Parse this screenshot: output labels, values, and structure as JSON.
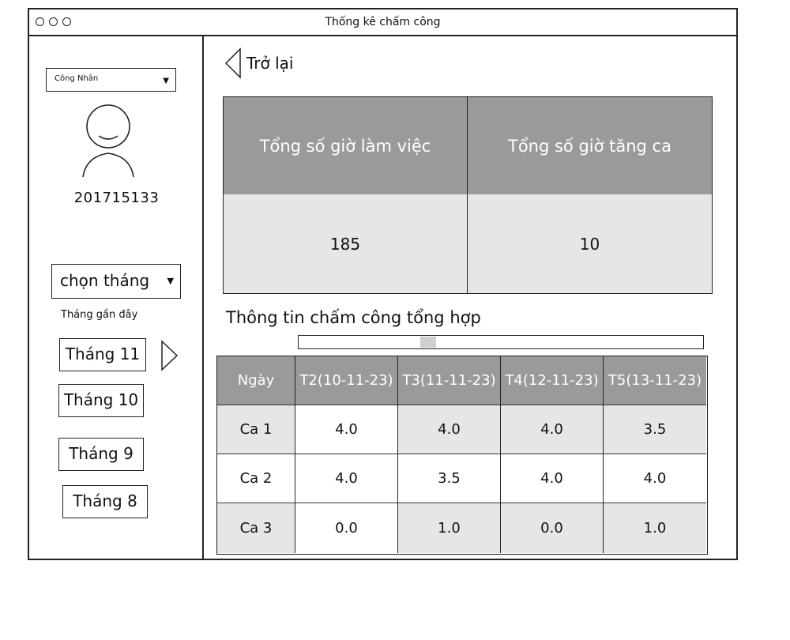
{
  "window": {
    "title": "Thống kê chấm công"
  },
  "sidebar": {
    "role_select": "Công Nhân",
    "employee_id": "201715133",
    "month_select": "chọn tháng",
    "recent_label": "Tháng gần đây",
    "months": [
      "Tháng 11",
      "Tháng 10",
      "Tháng 9",
      "Tháng 8"
    ]
  },
  "main": {
    "back_label": "Trở lại",
    "summary": {
      "headers": [
        "Tổng số giờ làm việc",
        "Tổng số giờ tăng ca"
      ],
      "values": [
        "185",
        "10"
      ]
    },
    "section_title": "Thông tin chấm công tổng hợp",
    "table": {
      "headers": [
        "Ngày",
        "T2(10-11-23)",
        "T3(11-11-23)",
        "T4(12-11-23)",
        "T5(13-11-23)"
      ],
      "rows": [
        [
          "Ca 1",
          "4.0",
          "4.0",
          "4.0",
          "3.5"
        ],
        [
          "Ca 2",
          "4.0",
          "3.5",
          "4.0",
          "4.0"
        ],
        [
          "Ca 3",
          "0.0",
          "1.0",
          "0.0",
          "1.0"
        ]
      ]
    }
  }
}
